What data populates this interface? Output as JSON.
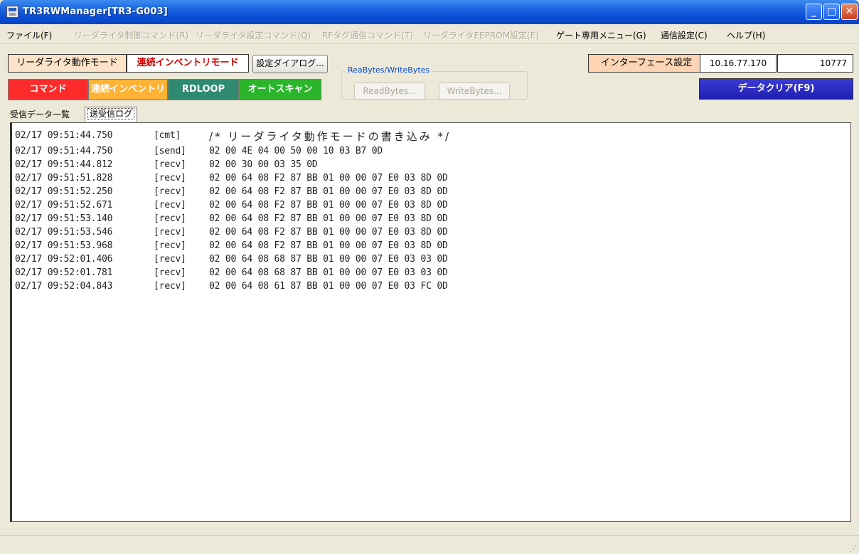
{
  "window": {
    "title": "TR3RWManager[TR3-G003]",
    "min_glyph": "_",
    "max_glyph": "□",
    "close_glyph": "✕"
  },
  "menu": {
    "items": [
      {
        "label": "ファイル(F)",
        "enabled": true
      },
      {
        "label": "リーダライタ制御コマンド(R)",
        "enabled": false
      },
      {
        "label": "リーダライタ設定コマンド(Q)",
        "enabled": false
      },
      {
        "label": "RFタグ通信コマンド(T)",
        "enabled": false
      },
      {
        "label": "リーダライタEEPROM設定(E)",
        "enabled": false
      },
      {
        "label": "ゲート専用メニュー(G)",
        "enabled": true
      },
      {
        "label": "通信設定(C)",
        "enabled": true
      },
      {
        "label": "ヘルプ(H)",
        "enabled": true
      }
    ]
  },
  "toolbar": {
    "mode_label": "リーダライタ動作モード",
    "mode_value": "連続インベントリモード",
    "settings_button": "設定ダイアログ...",
    "group_title": "ReaBytes/WriteBytes",
    "read_button": "ReadBytes...",
    "write_button": "WriteBytes...",
    "command_button": "コマンド",
    "inventory_button": "連続インベントリ",
    "rdloop_button": "RDLOOP",
    "autoscan_button": "オートスキャン",
    "interface_label": "インターフェース設定",
    "ip_address": "10.16.77.170",
    "port": "10777",
    "clear_button": "データクリア(F9)"
  },
  "tabs": {
    "recv_list": "受信データ一覧",
    "log": "送受信ログ"
  },
  "log": [
    {
      "ts": "02/17 09:51:44.750",
      "kind": "[cmt]",
      "body": "/* リーダライタ動作モードの書き込み */"
    },
    {
      "ts": "02/17 09:51:44.750",
      "kind": "[send]",
      "body": "02 00 4E 04 00 50 00 10 03 B7 0D"
    },
    {
      "ts": "02/17 09:51:44.812",
      "kind": "[recv]",
      "body": "02 00 30 00 03 35 0D"
    },
    {
      "ts": "02/17 09:51:51.828",
      "kind": "[recv]",
      "body": "02 00 64 08 F2 87 BB 01 00 00 07 E0 03 8D 0D"
    },
    {
      "ts": "02/17 09:51:52.250",
      "kind": "[recv]",
      "body": "02 00 64 08 F2 87 BB 01 00 00 07 E0 03 8D 0D"
    },
    {
      "ts": "02/17 09:51:52.671",
      "kind": "[recv]",
      "body": "02 00 64 08 F2 87 BB 01 00 00 07 E0 03 8D 0D"
    },
    {
      "ts": "02/17 09:51:53.140",
      "kind": "[recv]",
      "body": "02 00 64 08 F2 87 BB 01 00 00 07 E0 03 8D 0D"
    },
    {
      "ts": "02/17 09:51:53.546",
      "kind": "[recv]",
      "body": "02 00 64 08 F2 87 BB 01 00 00 07 E0 03 8D 0D"
    },
    {
      "ts": "02/17 09:51:53.968",
      "kind": "[recv]",
      "body": "02 00 64 08 F2 87 BB 01 00 00 07 E0 03 8D 0D"
    },
    {
      "ts": "02/17 09:52:01.406",
      "kind": "[recv]",
      "body": "02 00 64 08 68 87 BB 01 00 00 07 E0 03 03 0D"
    },
    {
      "ts": "02/17 09:52:01.781",
      "kind": "[recv]",
      "body": "02 00 64 08 68 87 BB 01 00 00 07 E0 03 03 0D"
    },
    {
      "ts": "02/17 09:52:04.843",
      "kind": "[recv]",
      "body": "02 00 64 08 61 87 BB 01 00 00 07 E0 03 FC 0D"
    }
  ]
}
